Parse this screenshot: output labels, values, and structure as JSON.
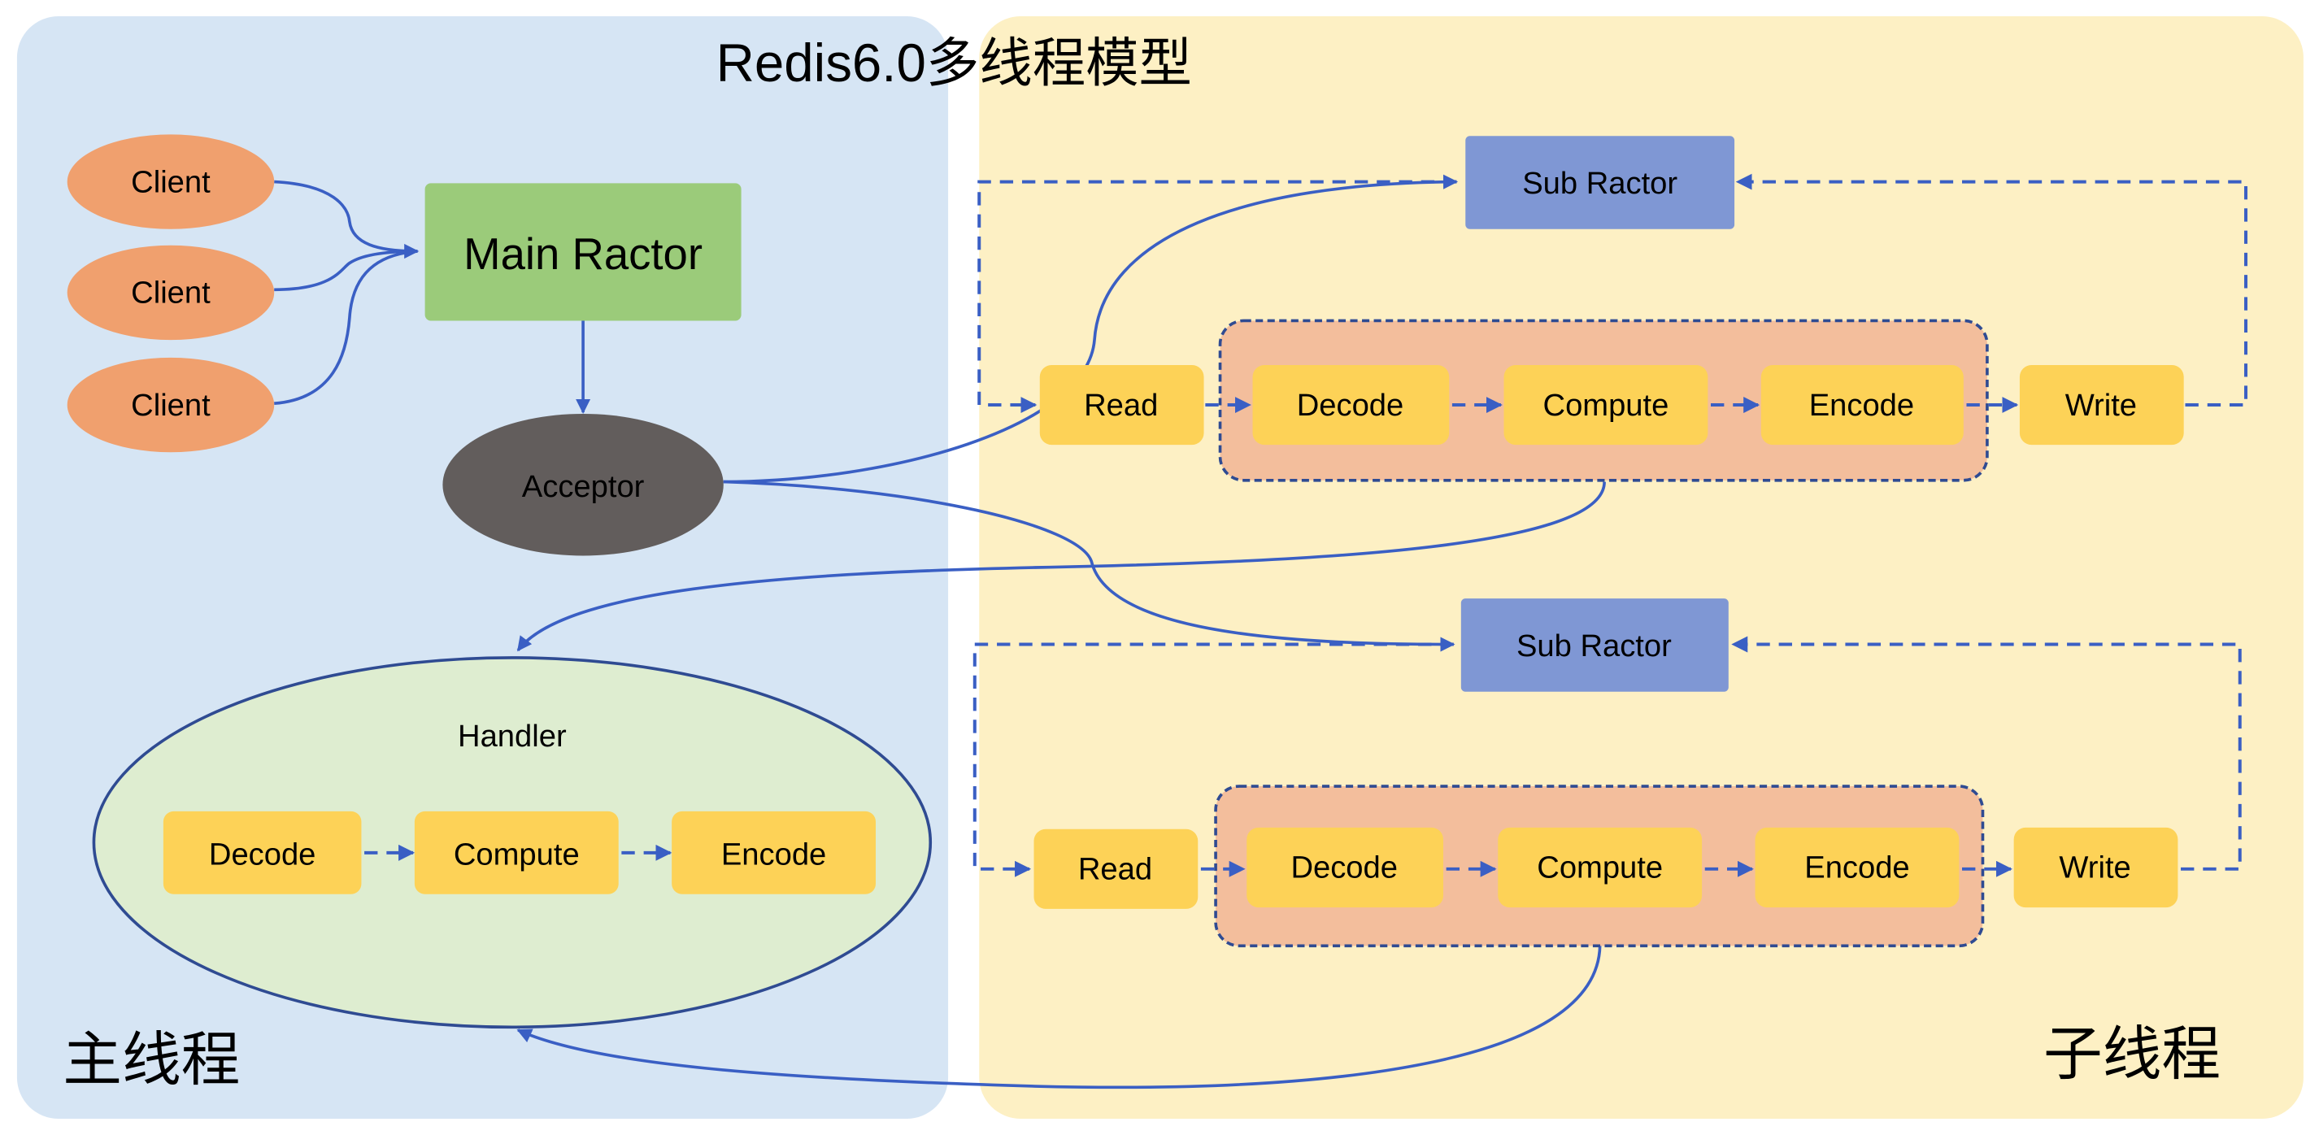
{
  "title": "Redis6.0多线程模型",
  "colors": {
    "main_panel": "#d6e5f4",
    "sub_panel": "#fdf0c4",
    "client": "#f0a06e",
    "main_reactor": "#9bcb7a",
    "acceptor": "#625d5c",
    "handler": "#deedd0",
    "handler_border": "#2f4b92",
    "sub_reactor": "#7f97d4",
    "stage_box": "#fdd257",
    "group_box": "#f3be9c",
    "arrow": "#3a5fc4"
  },
  "main_thread": {
    "label": "主线程",
    "clients": [
      {
        "label": "Client"
      },
      {
        "label": "Client"
      },
      {
        "label": "Client"
      }
    ],
    "main_reactor": {
      "label": "Main Ractor"
    },
    "acceptor": {
      "label": "Acceptor"
    },
    "handler": {
      "label": "Handler",
      "stages": [
        {
          "label": "Decode"
        },
        {
          "label": "Compute"
        },
        {
          "label": "Encode"
        }
      ]
    }
  },
  "sub_threads": {
    "label": "子线程",
    "groups": [
      {
        "sub_reactor": {
          "label": "Sub Ractor"
        },
        "read": {
          "label": "Read"
        },
        "stages": [
          {
            "label": "Decode"
          },
          {
            "label": "Compute"
          },
          {
            "label": "Encode"
          }
        ],
        "write": {
          "label": "Write"
        }
      },
      {
        "sub_reactor": {
          "label": "Sub Ractor"
        },
        "read": {
          "label": "Read"
        },
        "stages": [
          {
            "label": "Decode"
          },
          {
            "label": "Compute"
          },
          {
            "label": "Encode"
          }
        ],
        "write": {
          "label": "Write"
        }
      }
    ]
  }
}
